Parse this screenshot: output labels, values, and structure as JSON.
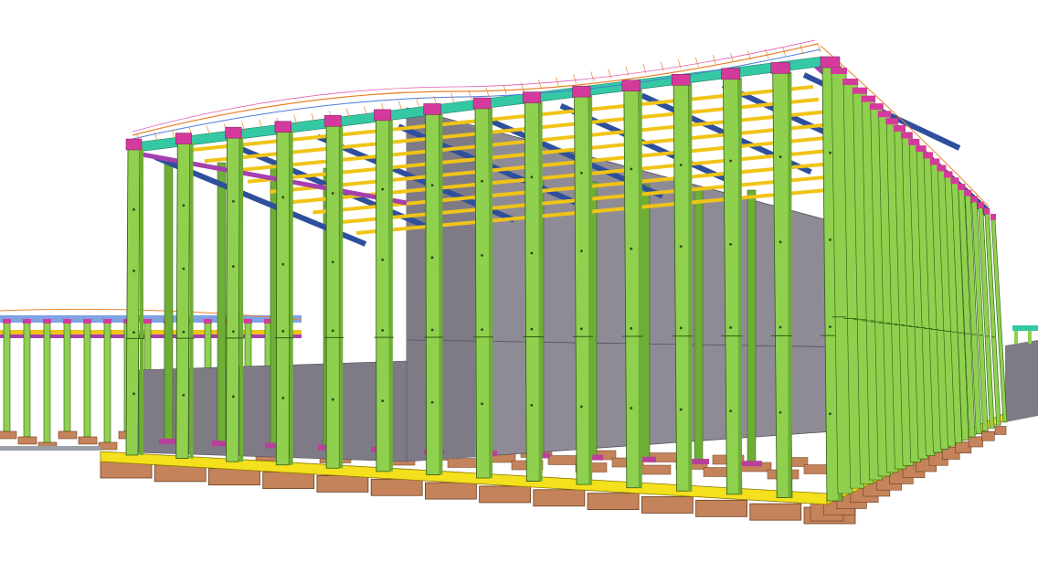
{
  "scene": {
    "kind": "3d-structural-steel-model",
    "colors": {
      "background": "#ffffff",
      "column": "#8fd14f",
      "column_edge": "#2f5a12",
      "column_shadow": "#6fae36",
      "wall": "#8f8b96",
      "wall_dark": "#7e7a86",
      "wall_edge": "#54515c",
      "ground_beam": "#f4e01c",
      "ground_beam_edge": "#8a7a00",
      "footing": "#c4835a",
      "footing_edge": "#6e3e20",
      "eave_beam": "#34c9a4",
      "purlin": "#f0c417",
      "rafter": "#2e4f9c",
      "bracing": "#a63fb0",
      "cap_plate": "#d43a9c",
      "roof_line_orange": "#e8842c",
      "roof_line_blue": "#4a7bd8",
      "roof_line_pink": "#e05fb0",
      "base_plate": "#b8409a"
    }
  }
}
